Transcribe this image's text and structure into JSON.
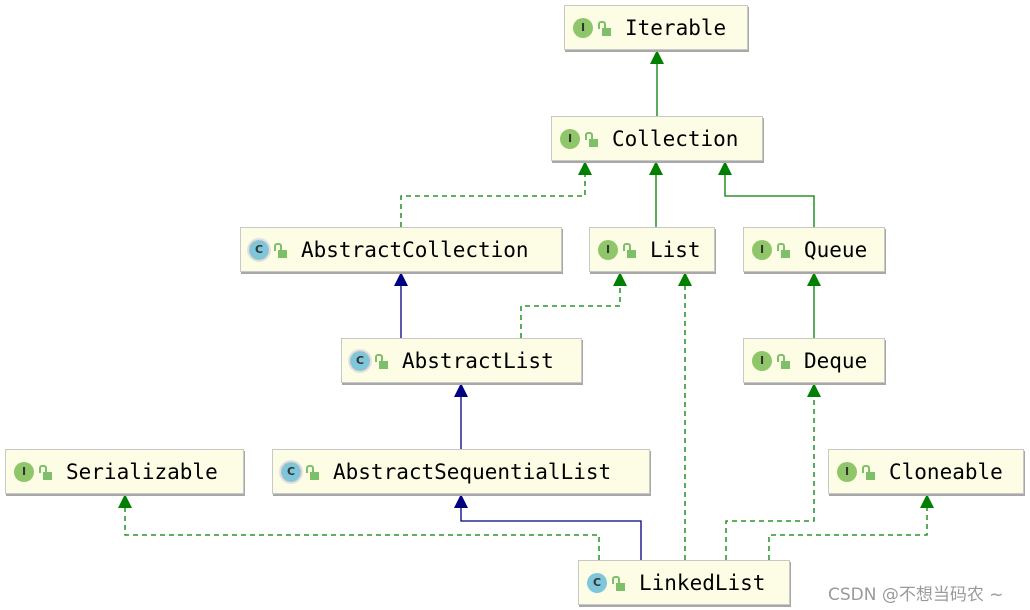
{
  "nodes": [
    {
      "id": "iterable",
      "name": "Iterable",
      "kind": "interface",
      "kind_letter": "I"
    },
    {
      "id": "collection",
      "name": "Collection",
      "kind": "interface",
      "kind_letter": "I"
    },
    {
      "id": "abstractcollection",
      "name": "AbstractCollection",
      "kind": "abstract-class",
      "kind_letter": "C"
    },
    {
      "id": "list",
      "name": "List",
      "kind": "interface",
      "kind_letter": "I"
    },
    {
      "id": "queue",
      "name": "Queue",
      "kind": "interface",
      "kind_letter": "I"
    },
    {
      "id": "abstractlist",
      "name": "AbstractList",
      "kind": "abstract-class",
      "kind_letter": "C"
    },
    {
      "id": "deque",
      "name": "Deque",
      "kind": "interface",
      "kind_letter": "I"
    },
    {
      "id": "serializable",
      "name": "Serializable",
      "kind": "interface",
      "kind_letter": "I"
    },
    {
      "id": "abstractsequentiallist",
      "name": "AbstractSequentialList",
      "kind": "abstract-class",
      "kind_letter": "C"
    },
    {
      "id": "cloneable",
      "name": "Cloneable",
      "kind": "interface",
      "kind_letter": "I"
    },
    {
      "id": "linkedlist",
      "name": "LinkedList",
      "kind": "class",
      "kind_letter": "C"
    }
  ],
  "edges": [
    {
      "from": "collection",
      "to": "iterable",
      "type": "extends"
    },
    {
      "from": "abstractcollection",
      "to": "collection",
      "type": "implements"
    },
    {
      "from": "list",
      "to": "collection",
      "type": "extends"
    },
    {
      "from": "queue",
      "to": "collection",
      "type": "extends"
    },
    {
      "from": "abstractlist",
      "to": "abstractcollection",
      "type": "class-extends"
    },
    {
      "from": "abstractlist",
      "to": "list",
      "type": "implements"
    },
    {
      "from": "deque",
      "to": "queue",
      "type": "extends"
    },
    {
      "from": "abstractsequentiallist",
      "to": "abstractlist",
      "type": "class-extends"
    },
    {
      "from": "linkedlist",
      "to": "abstractsequentiallist",
      "type": "class-extends"
    },
    {
      "from": "linkedlist",
      "to": "serializable",
      "type": "implements"
    },
    {
      "from": "linkedlist",
      "to": "list",
      "type": "implements"
    },
    {
      "from": "linkedlist",
      "to": "deque",
      "type": "implements"
    },
    {
      "from": "linkedlist",
      "to": "cloneable",
      "type": "implements"
    }
  ],
  "colors": {
    "extends": "#008000",
    "implements": "#008000",
    "class-extends": "#000080",
    "node_bg": "#fdfde6"
  },
  "watermark": "CSDN @不想当码农 ~"
}
